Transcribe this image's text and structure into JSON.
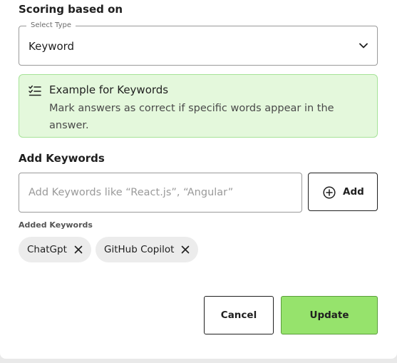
{
  "scoring": {
    "title": "Scoring based on",
    "select_legend": "Select Type",
    "select_value": "Keyword"
  },
  "info": {
    "icon": "checklist-icon",
    "title": "Example for Keywords",
    "description": "Mark answers as correct if specific words appear in the answer."
  },
  "keywords": {
    "title": "Add Keywords",
    "input_placeholder": "Add Keywords like “React.js”, “Angular”",
    "input_value": "",
    "add_label": "Add",
    "added_label": "Added Keywords",
    "chips": [
      {
        "label": "ChatGpt"
      },
      {
        "label": "GitHub Copilot"
      }
    ]
  },
  "actions": {
    "cancel_label": "Cancel",
    "update_label": "Update"
  },
  "colors": {
    "accent_green": "#96e36c",
    "info_bg": "#e4f8dc",
    "info_border": "#a6e398"
  }
}
